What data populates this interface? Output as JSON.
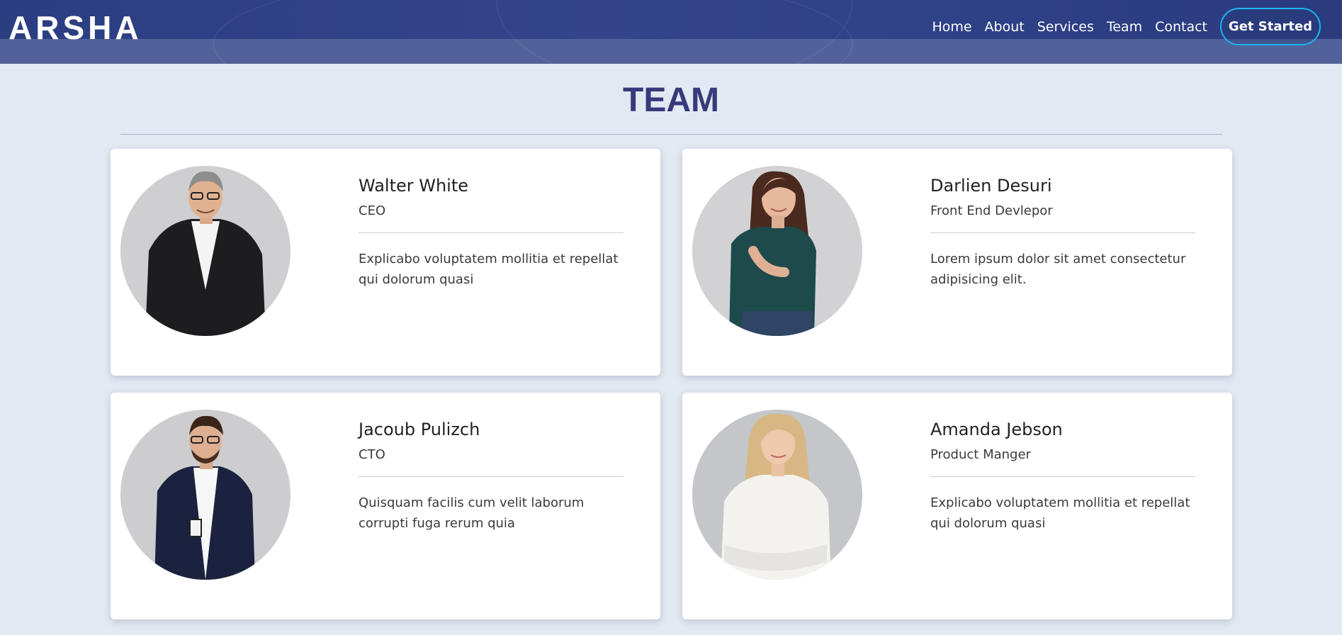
{
  "brand": {
    "logo": "ARSHA"
  },
  "nav": {
    "items": [
      {
        "label": "Home"
      },
      {
        "label": "About"
      },
      {
        "label": "Services"
      },
      {
        "label": "Team"
      },
      {
        "label": "Contact"
      }
    ],
    "cta_label": "Get Started"
  },
  "section": {
    "title": "TEAM"
  },
  "team": [
    {
      "name": "Walter White",
      "role": "CEO",
      "bio": "Explicabo voluptatem mollitia et repellat qui dolorum quasi"
    },
    {
      "name": "Darlien Desuri",
      "role": "Front End Devlepor",
      "bio": "Lorem ipsum dolor sit amet consectetur adipisicing elit."
    },
    {
      "name": "Jacoub Pulizch",
      "role": "CTO",
      "bio": "Quisquam facilis cum velit laborum corrupti fuga rerum quia"
    },
    {
      "name": "Amanda Jebson",
      "role": "Product Manger",
      "bio": "Explicabo voluptatem mollitia et repellat qui dolorum quasi"
    }
  ],
  "colors": {
    "header": "#2c3e82",
    "accent": "#1bb5ef",
    "title": "#37397a",
    "page_bg": "#e2e9f2"
  }
}
